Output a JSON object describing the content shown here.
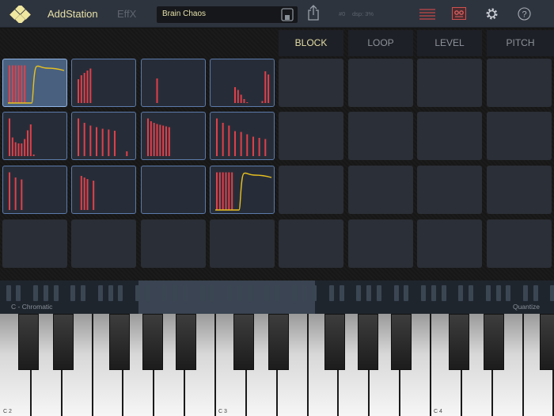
{
  "header": {
    "app_name": "AddStation",
    "effx_label": "EffX",
    "preset_name": "Brain Chaos",
    "status_voice": "#0",
    "status_dsp": "dsp: 3%"
  },
  "colors": {
    "accent": "#e6e0a8",
    "bar": "#e0404a",
    "envelope": "#e8c020",
    "pad_border": "#5b7aaa"
  },
  "icons": [
    "logo-icon",
    "save-icon",
    "share-icon",
    "menu-icon",
    "recorder-icon",
    "gear-icon",
    "help-icon"
  ],
  "tabs": [
    {
      "label": "BLOCK",
      "active": true
    },
    {
      "label": "LOOP"
    },
    {
      "label": "LEVEL"
    },
    {
      "label": "PITCH"
    }
  ],
  "pads": [
    {
      "bars": [
        [
          0,
          0.95
        ],
        [
          1,
          0.95
        ],
        [
          2,
          0.95
        ],
        [
          3,
          0.95
        ],
        [
          4,
          0.95
        ],
        [
          5,
          0.95
        ]
      ],
      "envelope": true,
      "selected": true
    },
    {
      "bars": [
        [
          0,
          0.6
        ],
        [
          1,
          0.7
        ],
        [
          2,
          0.76
        ],
        [
          3,
          0.82
        ],
        [
          4,
          0.87
        ]
      ]
    },
    {
      "bars": [
        [
          3,
          0.62
        ]
      ]
    },
    {
      "bars": [
        [
          6,
          0.4
        ],
        [
          7,
          0.33
        ],
        [
          8,
          0.21
        ],
        [
          9,
          0.1
        ],
        [
          10,
          0.02
        ],
        [
          15,
          0.05
        ],
        [
          16,
          0.8
        ],
        [
          17,
          0.72
        ]
      ]
    },
    {
      "bars": [
        [
          0,
          0.95
        ],
        [
          1,
          0.47
        ],
        [
          2,
          0.35
        ],
        [
          3,
          0.32
        ],
        [
          4,
          0.32
        ],
        [
          5,
          0.43
        ],
        [
          6,
          0.65
        ],
        [
          7,
          0.8
        ],
        [
          8,
          0.04
        ]
      ]
    },
    {
      "bars": [
        [
          0,
          0.95
        ],
        [
          2,
          0.84
        ],
        [
          4,
          0.77
        ],
        [
          6,
          0.73
        ],
        [
          8,
          0.69
        ],
        [
          10,
          0.67
        ],
        [
          12,
          0.64
        ],
        [
          16,
          0.12
        ]
      ]
    },
    {
      "bars": [
        [
          0,
          0.95
        ],
        [
          1,
          0.88
        ],
        [
          2,
          0.84
        ],
        [
          3,
          0.81
        ],
        [
          4,
          0.79
        ],
        [
          5,
          0.77
        ],
        [
          6,
          0.75
        ],
        [
          7,
          0.73
        ]
      ]
    },
    {
      "bars": [
        [
          0,
          0.95
        ],
        [
          2,
          0.84
        ],
        [
          4,
          0.77
        ],
        [
          6,
          0.63
        ],
        [
          8,
          0.61
        ],
        [
          10,
          0.55
        ],
        [
          12,
          0.49
        ],
        [
          14,
          0.46
        ],
        [
          16,
          0.43
        ]
      ]
    },
    {
      "bars": [
        [
          0,
          0.95
        ],
        [
          2,
          0.82
        ],
        [
          4,
          0.77
        ]
      ]
    },
    {
      "bars": [
        [
          1,
          0.86
        ],
        [
          2,
          0.82
        ],
        [
          3,
          0.78
        ],
        [
          5,
          0.74
        ]
      ]
    },
    {
      "bars": []
    },
    {
      "bars": [
        [
          0,
          0.95
        ],
        [
          1,
          0.95
        ],
        [
          2,
          0.95
        ],
        [
          3,
          0.95
        ],
        [
          4,
          0.95
        ],
        [
          5,
          0.95
        ]
      ],
      "envelope": true
    }
  ],
  "keyboard": {
    "scale_label": "C - Chromatic",
    "quantize_label": "Quantize",
    "octave_labels": [
      "C 2",
      "C 3",
      "C 4"
    ]
  }
}
